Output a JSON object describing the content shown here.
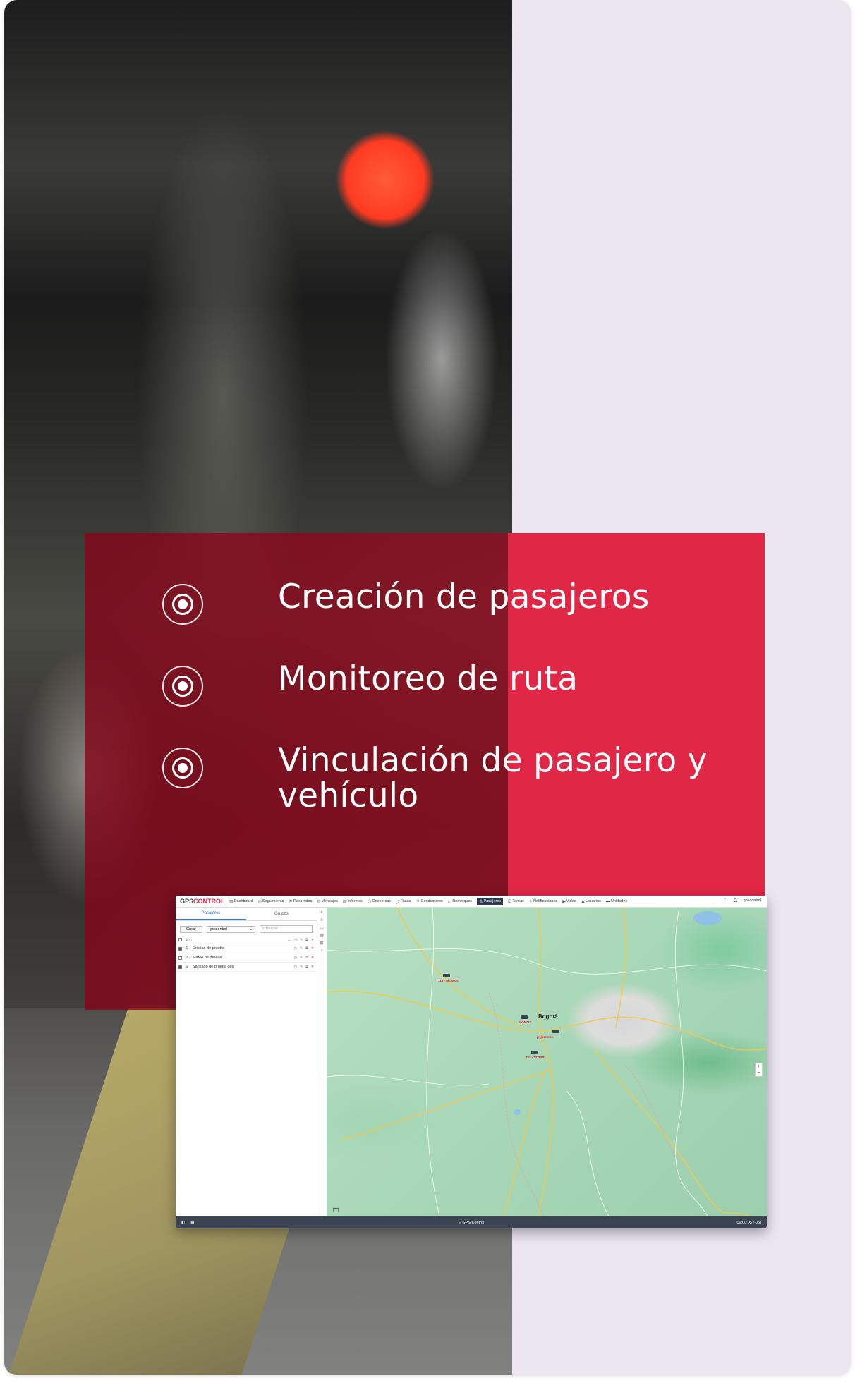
{
  "features": [
    {
      "label": "Creación de pasajeros"
    },
    {
      "label": "Monitoreo de ruta"
    },
    {
      "label": "Vinculación de pasajero y vehículo"
    }
  ],
  "app": {
    "logo_gps": "GPS",
    "logo_control": "CONTROL",
    "nav": [
      {
        "label": "Dashboard",
        "icon": "dashboard-icon"
      },
      {
        "label": "Seguimiento",
        "icon": "tracking-icon"
      },
      {
        "label": "Recorridos",
        "icon": "routes-history-icon"
      },
      {
        "label": "Mensajes",
        "icon": "messages-icon"
      },
      {
        "label": "Informes",
        "icon": "reports-icon"
      },
      {
        "label": "Geocercas",
        "icon": "geofence-icon"
      },
      {
        "label": "Rutas",
        "icon": "route-icon"
      },
      {
        "label": "Conductores",
        "icon": "driver-icon"
      },
      {
        "label": "Remolques",
        "icon": "trailer-icon"
      },
      {
        "label": "Pasajeros",
        "icon": "passenger-icon",
        "active": true
      },
      {
        "label": "Tareas",
        "icon": "tasks-icon"
      },
      {
        "label": "Notificaciones",
        "icon": "notifications-icon"
      },
      {
        "label": "Video",
        "icon": "video-icon"
      },
      {
        "label": "Usuarios",
        "icon": "users-icon"
      },
      {
        "label": "Unidades",
        "icon": "units-icon"
      }
    ],
    "user": "gpscontrol",
    "tabs": {
      "passengers": "Pasajeros",
      "groups": "Grupos"
    },
    "create_button": "Crear",
    "account_select": "gpscontrol",
    "search_placeholder": "Buscar",
    "passengers": [
      {
        "name": "Cristian de prueba",
        "checked": true
      },
      {
        "name": "Mateo de prueba",
        "checked": false
      },
      {
        "name": "Santiago de prueba dos",
        "checked": true
      }
    ],
    "map": {
      "city": "Bogotá",
      "vehicle_labels": [
        "113 - MCS070",
        "SKW787",
        "jerjpenn0...",
        "757 - 777898"
      ]
    },
    "footer": {
      "copyright": "© GPS Control",
      "time": "09:00:05 (-05)"
    }
  }
}
